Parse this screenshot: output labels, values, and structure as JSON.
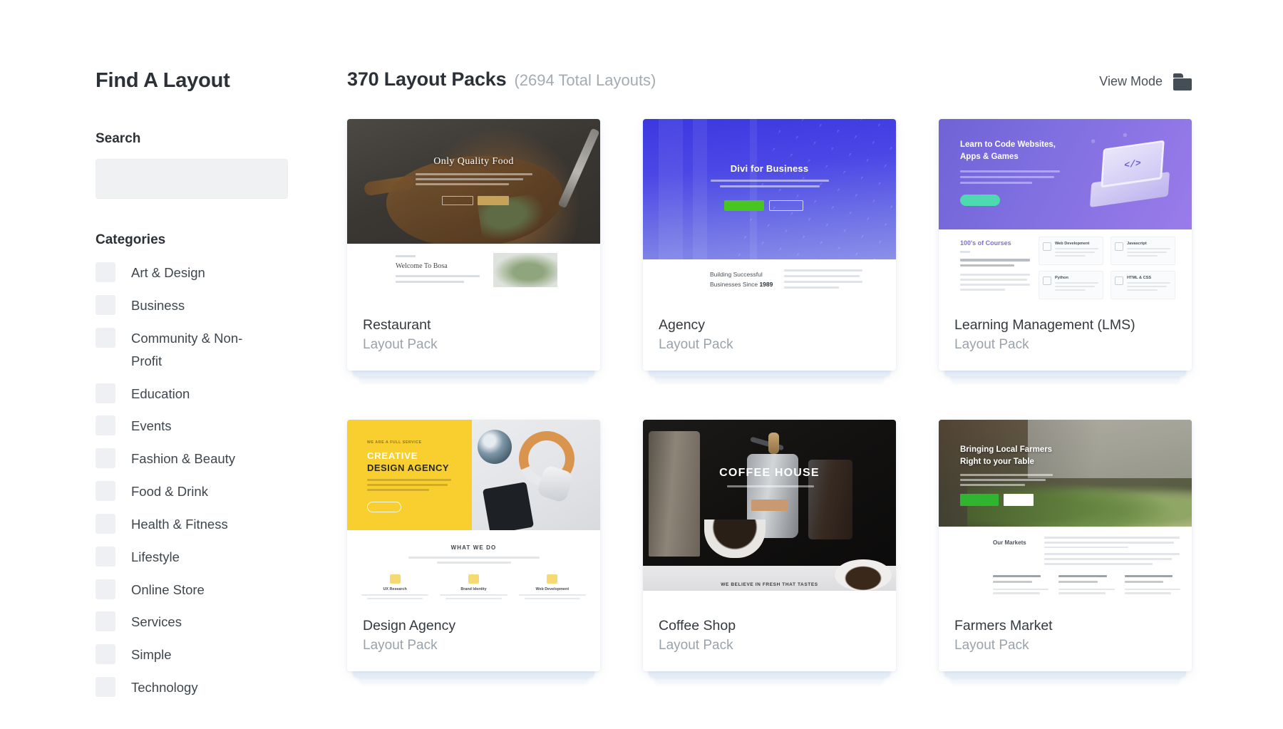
{
  "sidebar": {
    "title": "Find A Layout",
    "search_label": "Search",
    "search_value": "",
    "search_placeholder": "",
    "categories_label": "Categories",
    "categories": [
      {
        "label": "Art & Design",
        "checked": false
      },
      {
        "label": "Business",
        "checked": false
      },
      {
        "label": "Community & Non-Profit",
        "checked": false
      },
      {
        "label": "Education",
        "checked": false
      },
      {
        "label": "Events",
        "checked": false
      },
      {
        "label": "Fashion & Beauty",
        "checked": false
      },
      {
        "label": "Food & Drink",
        "checked": false
      },
      {
        "label": "Health & Fitness",
        "checked": false
      },
      {
        "label": "Lifestyle",
        "checked": false
      },
      {
        "label": "Online Store",
        "checked": false
      },
      {
        "label": "Services",
        "checked": false
      },
      {
        "label": "Simple",
        "checked": false
      },
      {
        "label": "Technology",
        "checked": false
      }
    ]
  },
  "header": {
    "packs_count": "370 Layout Packs",
    "total_layouts": "(2694 Total Layouts)",
    "view_mode_label": "View Mode",
    "view_mode_icon": "folder-icon"
  },
  "colors": {
    "text_dark": "#2b3137",
    "text_muted": "#9aa2aa",
    "checkbox_bg": "#eef0f3",
    "input_bg": "#f0f1f2",
    "card_stack": "#eaf2fa",
    "agency_accent": "#48c520",
    "lms_accent": "#4fd9b0",
    "design_accent": "#f9cf30",
    "farm_accent": "#2fb52f",
    "coffee_accent": "#c89a72"
  },
  "cards": [
    {
      "title": "Restaurant",
      "subtitle": "Layout Pack",
      "thumb": {
        "hero_title": "Only Quality Food",
        "section_title": "Welcome To Bosa"
      }
    },
    {
      "title": "Agency",
      "subtitle": "Layout Pack",
      "thumb": {
        "hero_title": "Divi for Business",
        "section_line1": "Building Successful",
        "section_line2_prefix": "Businesses Since ",
        "section_line2_year": "1989"
      }
    },
    {
      "title": "Learning Management (LMS)",
      "subtitle": "Layout Pack",
      "thumb": {
        "hero_title_line1": "Learn to Code Websites,",
        "hero_title_line2": "Apps & Games",
        "section_title": "100's of Courses",
        "code_glyph": "</>",
        "courses": [
          "Web Development",
          "Javascript",
          "Python",
          "HTML & CSS"
        ]
      }
    },
    {
      "title": "Design Agency",
      "subtitle": "Layout Pack",
      "thumb": {
        "eyebrow": "WE ARE A FULL SERVICE",
        "hero_title_line1": "CREATIVE",
        "hero_title_line2": "DESIGN AGENCY",
        "section_title": "WHAT WE DO",
        "services": [
          "UX Research",
          "Brand Identity",
          "Web Development"
        ]
      }
    },
    {
      "title": "Coffee Shop",
      "subtitle": "Layout Pack",
      "thumb": {
        "hero_title": "COFFEE HOUSE",
        "tagline": "WE BELIEVE IN FRESH THAT TASTES"
      }
    },
    {
      "title": "Farmers Market",
      "subtitle": "Layout Pack",
      "thumb": {
        "hero_title_line1": "Bringing Local Farmers",
        "hero_title_line2": "Right to your Table",
        "section_title": "Our Markets"
      }
    }
  ]
}
